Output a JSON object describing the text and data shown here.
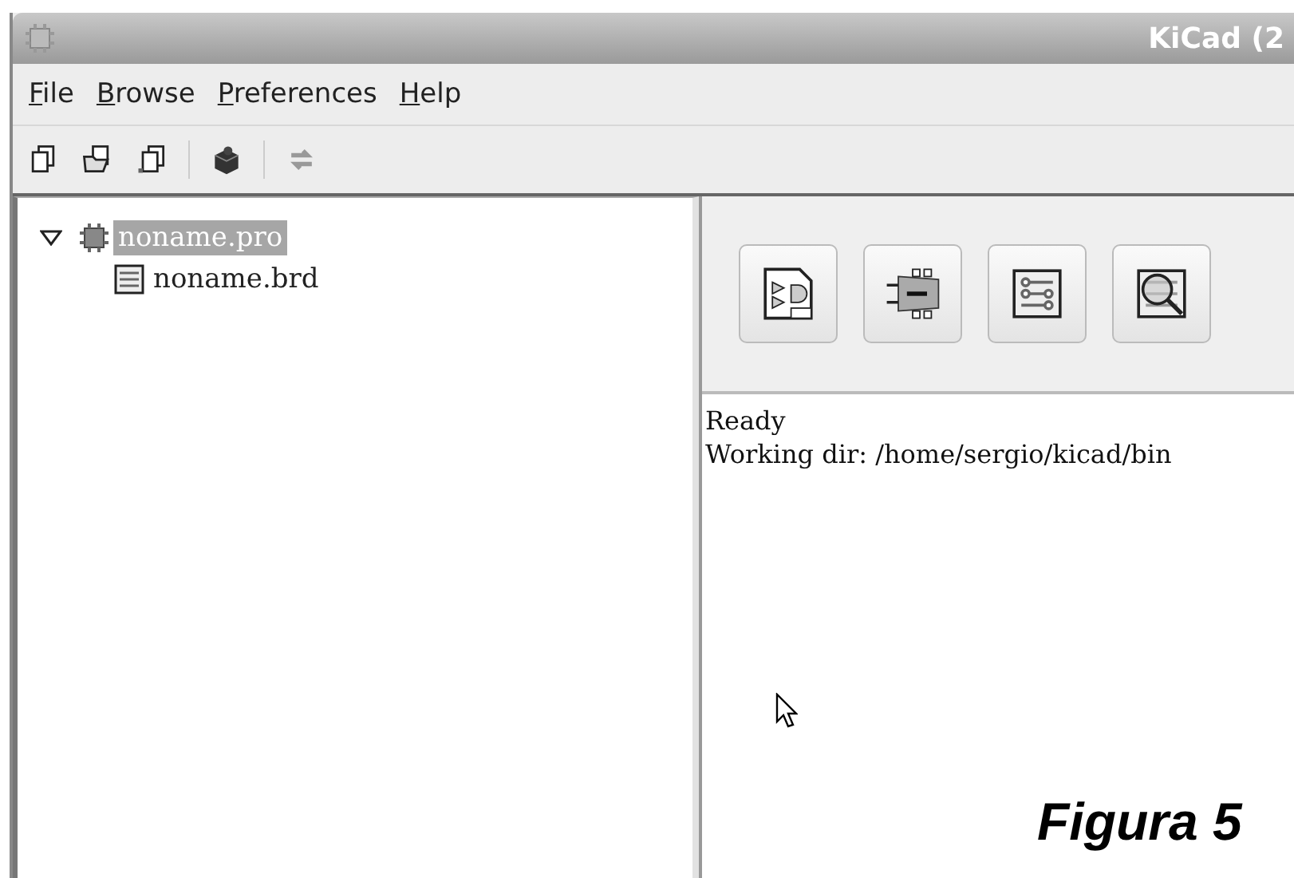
{
  "window": {
    "title": "KiCad (2"
  },
  "menu": [
    "File",
    "Browse",
    "Preferences",
    "Help"
  ],
  "tree": [
    {
      "label": "noname.pro",
      "kind": "project",
      "expanded": true,
      "selected": true,
      "children": [
        {
          "label": "noname.brd",
          "kind": "board",
          "selected": false
        }
      ]
    }
  ],
  "log": [
    "Ready",
    "Working dir: /home/sergio/kicad/bin"
  ],
  "caption": "Figura 5"
}
